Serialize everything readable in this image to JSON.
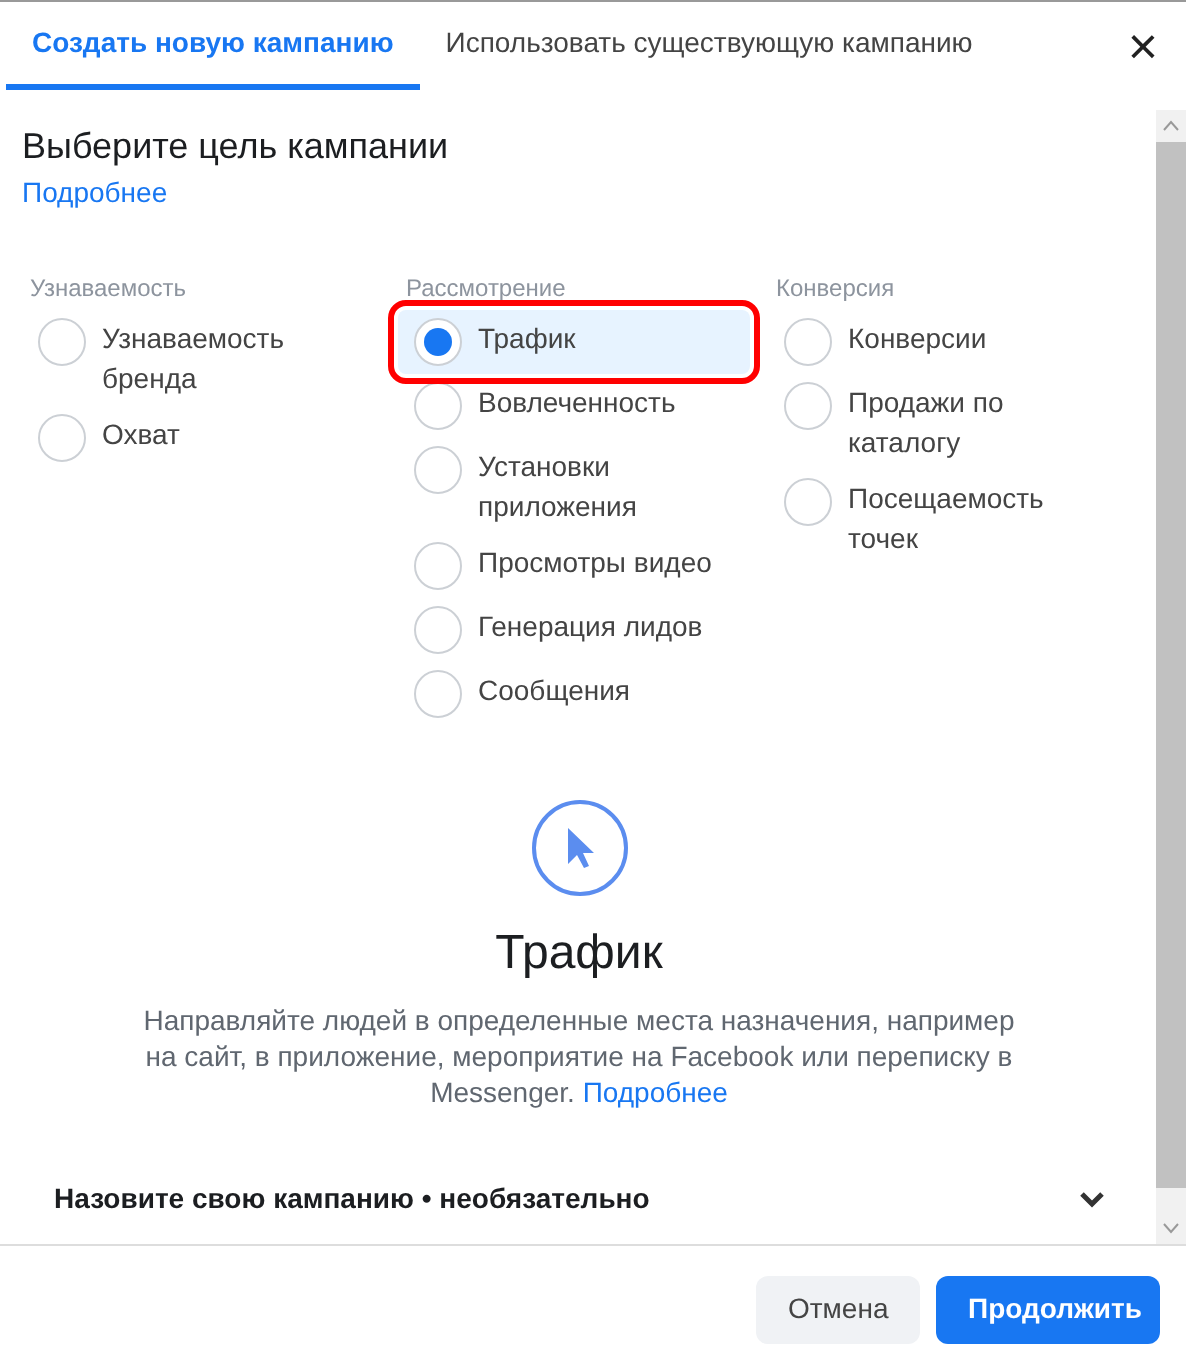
{
  "tabs": [
    {
      "label": "Создать новую кампанию",
      "selected": true
    },
    {
      "label": "Использовать существующую кампанию",
      "selected": false
    }
  ],
  "close": "×",
  "heading": "Выберите цель кампании",
  "learn_more": "Подробнее",
  "groups": [
    {
      "title": "Узнаваемость",
      "objectives": [
        {
          "label": "Узнаваемость бренда",
          "selected": false,
          "highlighted": false
        },
        {
          "label": "Охват",
          "selected": false,
          "highlighted": false
        }
      ]
    },
    {
      "title": "Рассмотрение",
      "objectives": [
        {
          "label": "Трафик",
          "selected": true,
          "highlighted": true
        },
        {
          "label": "Вовлеченность",
          "selected": false,
          "highlighted": false
        },
        {
          "label": "Установки приложения",
          "selected": false,
          "highlighted": false
        },
        {
          "label": "Просмотры видео",
          "selected": false,
          "highlighted": false
        },
        {
          "label": "Генерация лидов",
          "selected": false,
          "highlighted": false
        },
        {
          "label": "Сообщения",
          "selected": false,
          "highlighted": false
        }
      ]
    },
    {
      "title": "Конверсия",
      "objectives": [
        {
          "label": "Конверсии",
          "selected": false,
          "highlighted": false
        },
        {
          "label": "Продажи по каталогу",
          "selected": false,
          "highlighted": false
        },
        {
          "label": "Посещаемость точек",
          "selected": false,
          "highlighted": false
        }
      ]
    }
  ],
  "detail": {
    "title": "Трафик",
    "description": "Направляйте людей в определенные места назначения, например на сайт, в приложение, мероприятие на Facebook или переписку в Messenger.",
    "link": "Подробнее"
  },
  "name_section": {
    "label": "Назовите свою кампанию • необязательно",
    "expanded": false
  },
  "buttons": [
    {
      "label": "Отмена",
      "kind": "secondary"
    },
    {
      "label": "Продолжить",
      "kind": "primary"
    }
  ]
}
